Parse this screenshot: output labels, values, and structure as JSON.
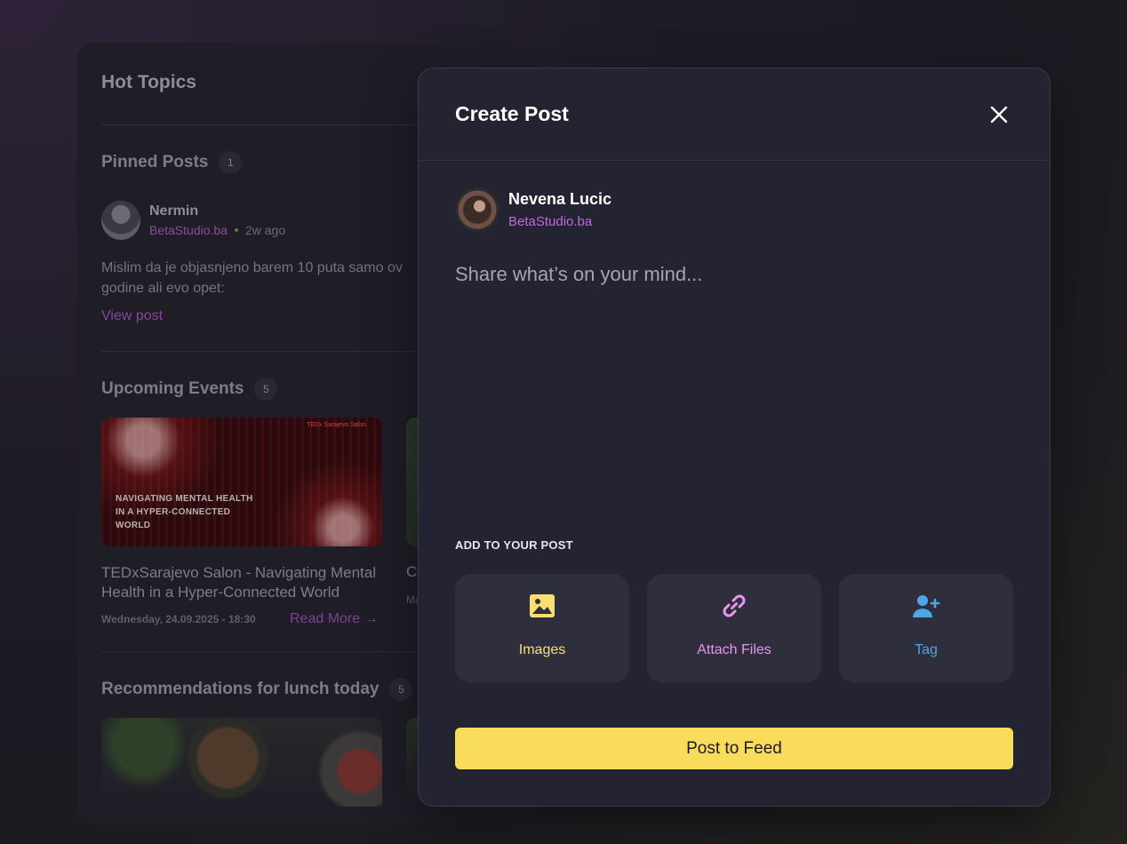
{
  "background": {
    "title": "Hot Topics",
    "pinned": {
      "title": "Pinned Posts",
      "count": "1",
      "author": "Nermin",
      "org": "BetaStudio.ba",
      "time": "2w ago",
      "text": "Mislim da je objasnjeno barem 10 puta samo ov godine ali evo opet:",
      "link": "View post"
    },
    "events": {
      "title": "Upcoming Events",
      "count": "5",
      "card_text": "NAVIGATING MENTAL HEALTH IN A HYPER-CONNECTED WORLD",
      "card_brand": "TEDx Sarajevo Salon",
      "event_title": "TEDxSarajevo Salon - Navigating Mental Health in a Hyper-Connected World",
      "event_date": "Wednesday, 24.09.2025 - 18:30",
      "read_more": "Read More →",
      "second_title": "C",
      "second_date": "Ma"
    },
    "lunch": {
      "title": "Recommendations for lunch today",
      "count": "5"
    }
  },
  "modal": {
    "title": "Create Post",
    "user": {
      "name": "Nevena Lucic",
      "org": "BetaStudio.ba"
    },
    "composer": {
      "placeholder": "Share what’s on your mind...",
      "value": ""
    },
    "add_label": "ADD TO YOUR POST",
    "actions": [
      {
        "label": "Images",
        "icon": "image-icon",
        "color": "#f9df73"
      },
      {
        "label": "Attach Files",
        "icon": "paperclip-icon",
        "color": "#ed93f0"
      },
      {
        "label": "Tag",
        "icon": "user-plus-icon",
        "color": "#4aa8e8"
      }
    ],
    "submit_label": "Post to Feed"
  },
  "colors": {
    "accent_yellow": "#f9dc5c",
    "accent_purple": "#c069e0",
    "modal_bg": "#232331"
  }
}
